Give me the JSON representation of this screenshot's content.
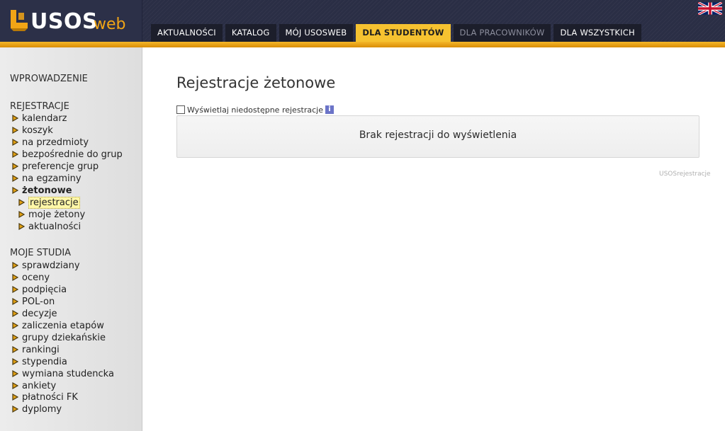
{
  "header": {
    "logo_main": "USOS",
    "logo_sub": "web",
    "tabs": [
      {
        "label": "AKTUALNOŚCI"
      },
      {
        "label": "KATALOG"
      },
      {
        "label": "MÓJ USOSWEB"
      },
      {
        "label": "DLA STUDENTÓW"
      },
      {
        "label": "DLA PRACOWNIKÓW"
      },
      {
        "label": "DLA WSZYSTKICH"
      }
    ]
  },
  "sidebar": {
    "intro": "WPROWADZENIE",
    "registrations_title": "REJESTRACJE",
    "registrations": [
      {
        "label": "kalendarz"
      },
      {
        "label": "koszyk"
      },
      {
        "label": "na przedmioty"
      },
      {
        "label": "bezpośrednie do grup"
      },
      {
        "label": "preferencje grup"
      },
      {
        "label": "na egzaminy"
      },
      {
        "label": "żetonowe"
      }
    ],
    "tokens_sub": [
      {
        "label": "rejestracje"
      },
      {
        "label": "moje żetony"
      },
      {
        "label": "aktualności"
      }
    ],
    "studies_title": "MOJE STUDIA",
    "studies": [
      {
        "label": "sprawdziany"
      },
      {
        "label": "oceny"
      },
      {
        "label": "podpięcia"
      },
      {
        "label": "POL-on"
      },
      {
        "label": "decyzje"
      },
      {
        "label": "zaliczenia etapów"
      },
      {
        "label": "grupy dziekańskie"
      },
      {
        "label": "rankingi"
      },
      {
        "label": "stypendia"
      },
      {
        "label": "wymiana studencka"
      },
      {
        "label": "ankiety"
      },
      {
        "label": "płatności FK"
      },
      {
        "label": "dyplomy"
      }
    ]
  },
  "main": {
    "title": "Rejestracje żetonowe",
    "checkbox_label": "Wyświetlaj niedostępne rejestracje",
    "info_glyph": "i",
    "empty_message": "Brak rejestracji do wyświetlenia",
    "footer_tag": "USOSrejestracje"
  },
  "colors": {
    "accent": "#f6c230",
    "header_bg": "#2a2e45",
    "bullet": "#e2a012"
  }
}
